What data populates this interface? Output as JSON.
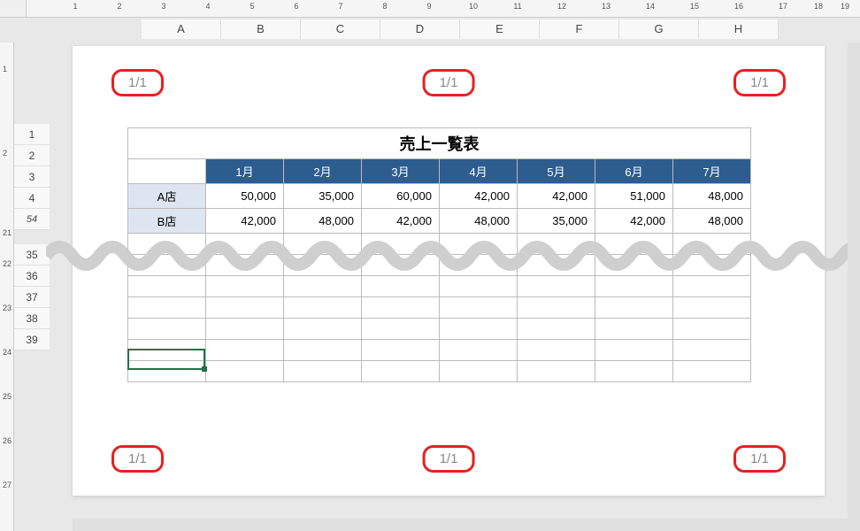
{
  "ruler_h": [
    "1",
    "2",
    "3",
    "4",
    "5",
    "6",
    "7",
    "8",
    "9",
    "10",
    "11",
    "12",
    "13",
    "14",
    "15",
    "16",
    "17",
    "18",
    "19"
  ],
  "ruler_v": [
    "1",
    "2",
    "21",
    "22",
    "23",
    "24",
    "25",
    "26",
    "27"
  ],
  "columns": [
    "A",
    "B",
    "C",
    "D",
    "E",
    "F",
    "G",
    "H"
  ],
  "rows_top": [
    "1",
    "2",
    "3",
    "4",
    "54"
  ],
  "rows_bot": [
    "35",
    "36",
    "37",
    "38",
    "39"
  ],
  "page_indicator": "1/1",
  "table": {
    "title": "売上一覧表",
    "months": [
      "1月",
      "2月",
      "3月",
      "4月",
      "5月",
      "6月",
      "7月"
    ],
    "rows": [
      {
        "name": "A店",
        "vals": [
          "50,000",
          "35,000",
          "60,000",
          "42,000",
          "42,000",
          "51,000",
          "48,000"
        ]
      },
      {
        "name": "B店",
        "vals": [
          "42,000",
          "48,000",
          "42,000",
          "48,000",
          "35,000",
          "42,000",
          "48,000"
        ]
      }
    ]
  },
  "selected_cell": "A39",
  "colors": {
    "header_bg": "#2d5c8f",
    "rowname_bg": "#dde6f0",
    "annotation": "#e82020",
    "selection": "#217346"
  }
}
